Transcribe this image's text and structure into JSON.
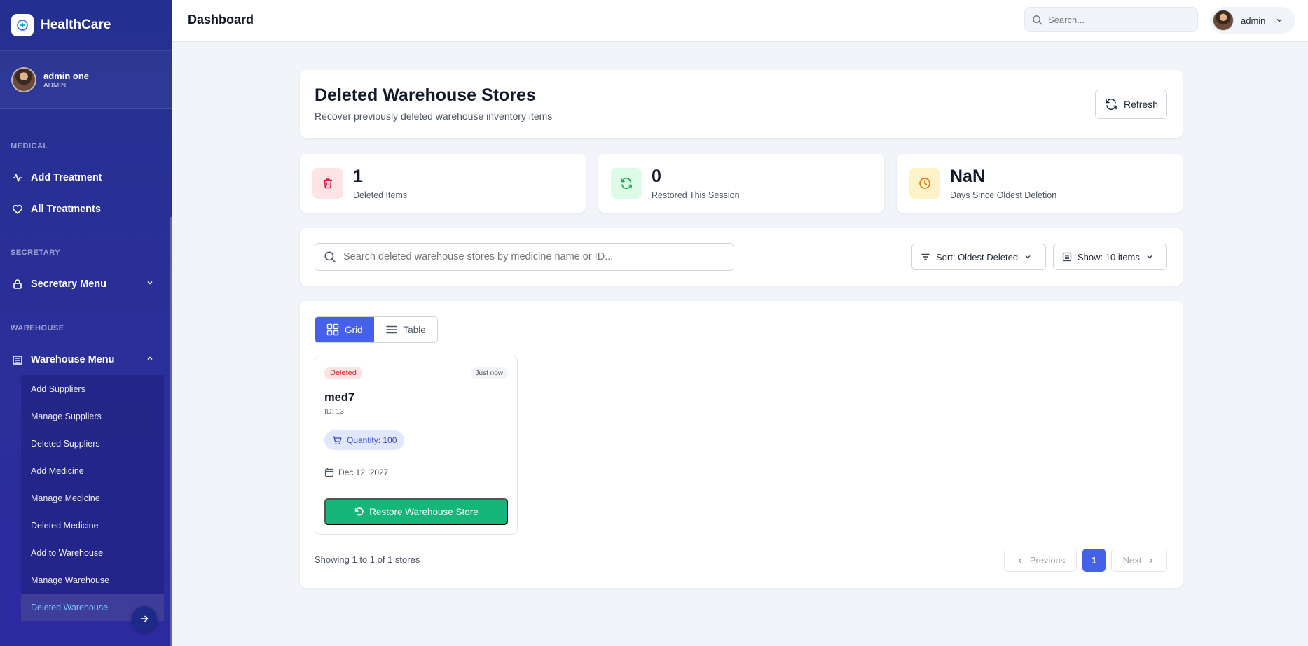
{
  "sidebar": {
    "brand": "HealthCare",
    "user": {
      "name": "admin one",
      "role": "ADMIN"
    },
    "sections": {
      "medical": "MEDICAL",
      "secretary": "SECRETARY",
      "warehouse": "WAREHOUSE"
    },
    "items": {
      "add_treatment": "Add Treatment",
      "all_treatments": "All Treatments",
      "secretary_menu": "Secretary Menu",
      "warehouse_menu": "Warehouse Menu"
    },
    "warehouse_sub": [
      "Add Suppliers",
      "Manage Suppliers",
      "Deleted Suppliers",
      "Add Medicine",
      "Manage Medicine",
      "Deleted Medicine",
      "Add to Warehouse",
      "Manage Warehouse",
      "Deleted Warehouse"
    ],
    "active_sub": "Deleted Warehouse"
  },
  "topbar": {
    "title": "Dashboard",
    "search_placeholder": "Search...",
    "user_name": "admin"
  },
  "header": {
    "title": "Deleted Warehouse Stores",
    "subtitle": "Recover previously deleted warehouse inventory items",
    "refresh_label": "Refresh"
  },
  "stats": [
    {
      "value": "1",
      "label": "Deleted Items",
      "icon": "trash-icon",
      "color": "#e11d48",
      "bg": "#ffe4e6"
    },
    {
      "value": "0",
      "label": "Restored This Session",
      "icon": "refresh-icon",
      "color": "#16a34a",
      "bg": "#dcfce7"
    },
    {
      "value": "NaN",
      "label": "Days Since Oldest Deletion",
      "icon": "clock-icon",
      "color": "#d97706",
      "bg": "#fef3c7"
    }
  ],
  "filters": {
    "search_placeholder": "Search deleted warehouse stores by medicine name or ID...",
    "sort_label": "Sort: Oldest Deleted",
    "show_label": "Show: 10 items"
  },
  "view_toggle": {
    "grid_label": "Grid",
    "table_label": "Table",
    "active": "grid"
  },
  "items": [
    {
      "status": "Deleted",
      "time": "Just now",
      "name": "med7",
      "id_label": "ID: 13",
      "quantity_label": "Quantity: 100",
      "date": "Dec 12, 2027",
      "restore_label": "Restore Warehouse Store"
    }
  ],
  "pagination": {
    "summary": "Showing 1 to 1 of 1 stores",
    "previous": "Previous",
    "next": "Next",
    "current_page": "1"
  },
  "colors": {
    "sidebar": "#2b2f9a",
    "accent": "#4461e8",
    "success": "#16b67a",
    "danger": "#dc2626"
  }
}
